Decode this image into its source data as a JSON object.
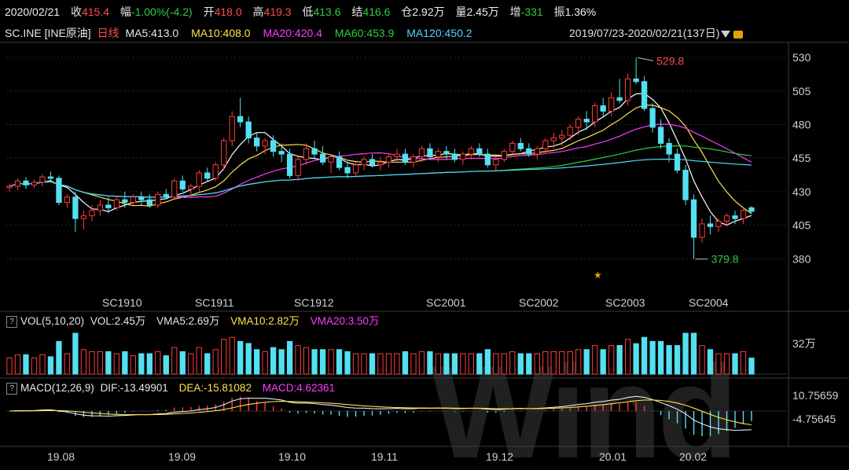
{
  "quote_bar": {
    "date": "2020/02/21",
    "close_label": "收",
    "close": "415.4",
    "chg_label": "幅",
    "chg": "-1.00%(-4.2)",
    "open_label": "开",
    "open": "418.0",
    "high_label": "高",
    "high": "419.3",
    "low_label": "低",
    "low": "413.6",
    "settle_label": "结",
    "settle": "416.6",
    "oi_label": "仓",
    "oi": "2.92万",
    "vol_label": "量",
    "vol": "2.45万",
    "oi_chg_label": "增",
    "oi_chg": "-331",
    "amp_label": "振",
    "amp": "1.36%"
  },
  "price_header": {
    "symbol": "SC.INE [INE原油]",
    "period": "日线",
    "ma5": "MA5:413.0",
    "ma10": "MA10:408.0",
    "ma20": "MA20:420.4",
    "ma60": "MA60:453.9",
    "ma120": "MA120:450.2",
    "range": "2019/07/23-2020/02/21(137日)"
  },
  "vol_header": {
    "q": "?",
    "name": "VOL(5,10,20)",
    "vol": "VOL:2.45万",
    "vma5": "VMA5:2.69万",
    "vma10": "VMA10:2.82万",
    "vma20": "VMA20:3.50万"
  },
  "macd_header": {
    "q": "?",
    "name": "MACD(12,26,9)",
    "dif": "DIF:-13.49901",
    "dea": "DEA:-15.81082",
    "macd": "MACD:4.62361"
  },
  "colors": {
    "up": "#ff3b3b",
    "down": "#54e0f0",
    "ma5": "#ffffff",
    "ma10": "#ffe14b",
    "ma20": "#ff3bff",
    "ma60": "#2ecc40",
    "ma120": "#4fd6ff"
  },
  "chart_data": [
    {
      "type": "candlestick",
      "title": "SC.INE [INE原油] 日线",
      "y_ticks": [
        "530",
        "505",
        "480",
        "455",
        "430",
        "405",
        "380"
      ],
      "ylim": [
        355,
        540
      ],
      "contract_labels": [
        "SC1910",
        "SC1911",
        "SC1912",
        "SC2001",
        "SC2002",
        "SC2003",
        "SC2004"
      ],
      "annotations": {
        "high": "529.8",
        "low": "379.8"
      },
      "candles": [
        [
          433,
          436,
          430,
          434
        ],
        [
          434,
          440,
          431,
          438
        ],
        [
          438,
          441,
          432,
          435
        ],
        [
          435,
          439,
          433,
          437
        ],
        [
          437,
          443,
          434,
          441
        ],
        [
          441,
          445,
          438,
          440
        ],
        [
          440,
          442,
          420,
          422
        ],
        [
          422,
          428,
          418,
          426
        ],
        [
          426,
          430,
          400,
          410
        ],
        [
          410,
          416,
          402,
          412
        ],
        [
          412,
          420,
          408,
          416
        ],
        [
          416,
          424,
          412,
          420
        ],
        [
          420,
          426,
          414,
          418
        ],
        [
          418,
          426,
          416,
          424
        ],
        [
          424,
          430,
          418,
          422
        ],
        [
          422,
          428,
          420,
          426
        ],
        [
          426,
          430,
          420,
          424
        ],
        [
          424,
          428,
          418,
          420
        ],
        [
          420,
          430,
          418,
          428
        ],
        [
          428,
          432,
          424,
          426
        ],
        [
          426,
          440,
          424,
          438
        ],
        [
          438,
          442,
          430,
          432
        ],
        [
          432,
          436,
          426,
          434
        ],
        [
          434,
          446,
          430,
          444
        ],
        [
          444,
          448,
          438,
          440
        ],
        [
          440,
          452,
          438,
          450
        ],
        [
          450,
          470,
          446,
          468
        ],
        [
          468,
          490,
          464,
          486
        ],
        [
          486,
          500,
          478,
          482
        ],
        [
          482,
          486,
          466,
          470
        ],
        [
          470,
          474,
          460,
          464
        ],
        [
          464,
          470,
          458,
          468
        ],
        [
          468,
          472,
          456,
          460
        ],
        [
          460,
          466,
          452,
          458
        ],
        [
          458,
          462,
          440,
          442
        ],
        [
          442,
          456,
          438,
          454
        ],
        [
          454,
          466,
          450,
          462
        ],
        [
          462,
          468,
          454,
          458
        ],
        [
          458,
          464,
          450,
          452
        ],
        [
          452,
          458,
          444,
          456
        ],
        [
          456,
          460,
          446,
          448
        ],
        [
          448,
          452,
          440,
          444
        ],
        [
          444,
          452,
          442,
          450
        ],
        [
          450,
          456,
          446,
          454
        ],
        [
          454,
          458,
          448,
          450
        ],
        [
          450,
          456,
          446,
          452
        ],
        [
          452,
          458,
          448,
          456
        ],
        [
          456,
          462,
          452,
          458
        ],
        [
          458,
          462,
          450,
          452
        ],
        [
          452,
          458,
          448,
          456
        ],
        [
          456,
          464,
          452,
          462
        ],
        [
          462,
          466,
          454,
          456
        ],
        [
          456,
          462,
          452,
          460
        ],
        [
          460,
          464,
          454,
          458
        ],
        [
          458,
          462,
          452,
          454
        ],
        [
          454,
          460,
          450,
          458
        ],
        [
          458,
          464,
          454,
          462
        ],
        [
          462,
          466,
          456,
          458
        ],
        [
          458,
          462,
          448,
          450
        ],
        [
          450,
          456,
          446,
          454
        ],
        [
          454,
          462,
          452,
          460
        ],
        [
          460,
          468,
          456,
          466
        ],
        [
          466,
          470,
          460,
          462
        ],
        [
          462,
          466,
          456,
          458
        ],
        [
          458,
          464,
          454,
          462
        ],
        [
          462,
          470,
          458,
          468
        ],
        [
          468,
          474,
          462,
          470
        ],
        [
          470,
          476,
          464,
          472
        ],
        [
          472,
          480,
          468,
          478
        ],
        [
          478,
          486,
          472,
          484
        ],
        [
          484,
          490,
          476,
          482
        ],
        [
          482,
          496,
          478,
          494
        ],
        [
          494,
          500,
          486,
          490
        ],
        [
          490,
          504,
          486,
          500
        ],
        [
          500,
          514,
          496,
          498
        ],
        [
          498,
          518,
          494,
          514
        ],
        [
          514,
          529.8,
          510,
          512
        ],
        [
          512,
          516,
          490,
          492
        ],
        [
          492,
          496,
          474,
          478
        ],
        [
          478,
          484,
          462,
          466
        ],
        [
          466,
          470,
          452,
          458
        ],
        [
          458,
          462,
          444,
          446
        ],
        [
          446,
          450,
          420,
          424
        ],
        [
          424,
          428,
          379.8,
          396
        ],
        [
          396,
          410,
          392,
          406
        ],
        [
          406,
          412,
          398,
          404
        ],
        [
          404,
          410,
          400,
          408
        ],
        [
          408,
          414,
          404,
          412
        ],
        [
          412,
          416,
          406,
          410
        ],
        [
          410,
          418,
          406,
          416
        ],
        [
          418,
          419.3,
          413.6,
          415.4
        ]
      ]
    },
    {
      "type": "bar",
      "title": "VOL(5,10,20)",
      "y_ticks": [
        "32万"
      ]
    },
    {
      "type": "bar",
      "title": "MACD(12,26,9)",
      "y_ticks": [
        "10.75659",
        "-4.75645"
      ],
      "x_labels": [
        "19.08",
        "19.09",
        "19.10",
        "19.11",
        "19.12",
        "20.01",
        "20.02"
      ]
    }
  ],
  "watermark": "Wind"
}
